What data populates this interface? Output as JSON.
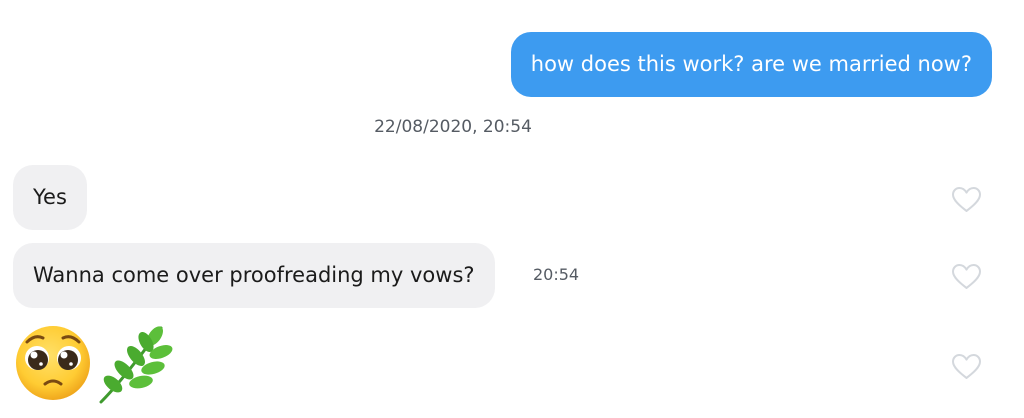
{
  "conversation": {
    "outgoing": [
      {
        "text": "how does this work? are we married now?"
      }
    ],
    "separator_timestamp": "22/08/2020, 20:54",
    "incoming": [
      {
        "text": "Yes",
        "liked": false
      },
      {
        "text": "Wanna come over proofreading my vows?",
        "time": "20:54",
        "liked": false
      },
      {
        "emojis": [
          "pleading-face-emoji",
          "herb-emoji"
        ],
        "liked": false
      }
    ]
  },
  "icons": [
    "heart-outline-icon",
    "pleading-face-emoji",
    "herb-emoji"
  ],
  "colors": {
    "outgoing_bubble": "#3d9bf0",
    "incoming_bubble": "#f0f0f2",
    "timestamp_text": "#555b63",
    "heart_outline": "#d4d8dd"
  }
}
